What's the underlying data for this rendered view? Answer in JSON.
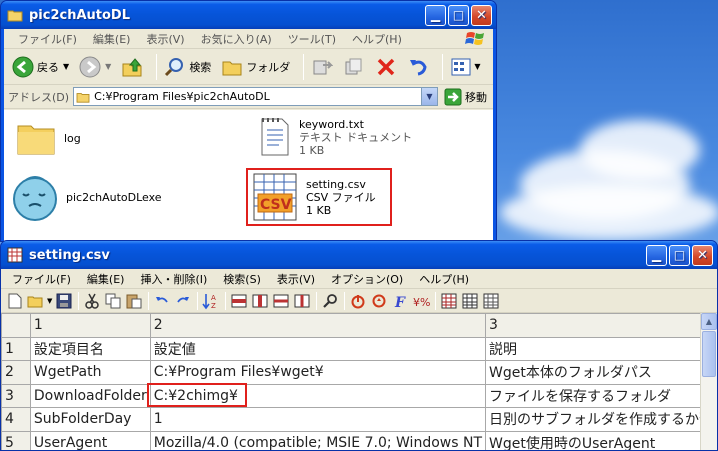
{
  "explorer": {
    "title": "pic2chAutoDL",
    "menu": [
      "ファイル(F)",
      "編集(E)",
      "表示(V)",
      "お気に入り(A)",
      "ツール(T)",
      "ヘルプ(H)"
    ],
    "toolbar": {
      "back_label": "戻る",
      "search_label": "検索",
      "folders_label": "フォルダ"
    },
    "address_label": "アドレス(D)",
    "address_value": "C:¥Program Files¥pic2chAutoDL",
    "go_label": "移動",
    "files": [
      {
        "name": "log"
      },
      {
        "name": "keyword.txt",
        "type": "テキスト ドキュメント",
        "size": "1 KB"
      },
      {
        "name": "pic2chAutoDLexe"
      },
      {
        "name": "setting.csv",
        "type": "CSV ファイル",
        "size": "1 KB"
      }
    ]
  },
  "csv_window": {
    "title": "setting.csv",
    "menu": [
      "ファイル(F)",
      "編集(E)",
      "挿入・削除(I)",
      "検索(S)",
      "表示(V)",
      "オプション(O)",
      "ヘルプ(H)"
    ]
  },
  "grid": {
    "column_headers": [
      "1",
      "2",
      "3"
    ],
    "rows": [
      {
        "num": "1",
        "cells": [
          "設定項目名",
          "設定値",
          "説明"
        ]
      },
      {
        "num": "2",
        "cells": [
          "WgetPath",
          "C:¥Program Files¥wget¥",
          "Wget本体のフォルダパス"
        ]
      },
      {
        "num": "3",
        "cells": [
          "DownloadFolder",
          "C:¥2chimg¥",
          "ファイルを保存するフォルダ"
        ]
      },
      {
        "num": "4",
        "cells": [
          "SubFolderDay",
          "1",
          "日別のサブフォルダを作成するか否"
        ]
      },
      {
        "num": "5",
        "cells": [
          "UserAgent",
          "Mozilla/4.0 (compatible; MSIE 7.0; Windows NT",
          "Wget使用時のUserAgent"
        ]
      }
    ]
  },
  "colors": {
    "highlight": "#e0201c",
    "xp_title": "#0654d8",
    "face": "#ece9d8"
  }
}
